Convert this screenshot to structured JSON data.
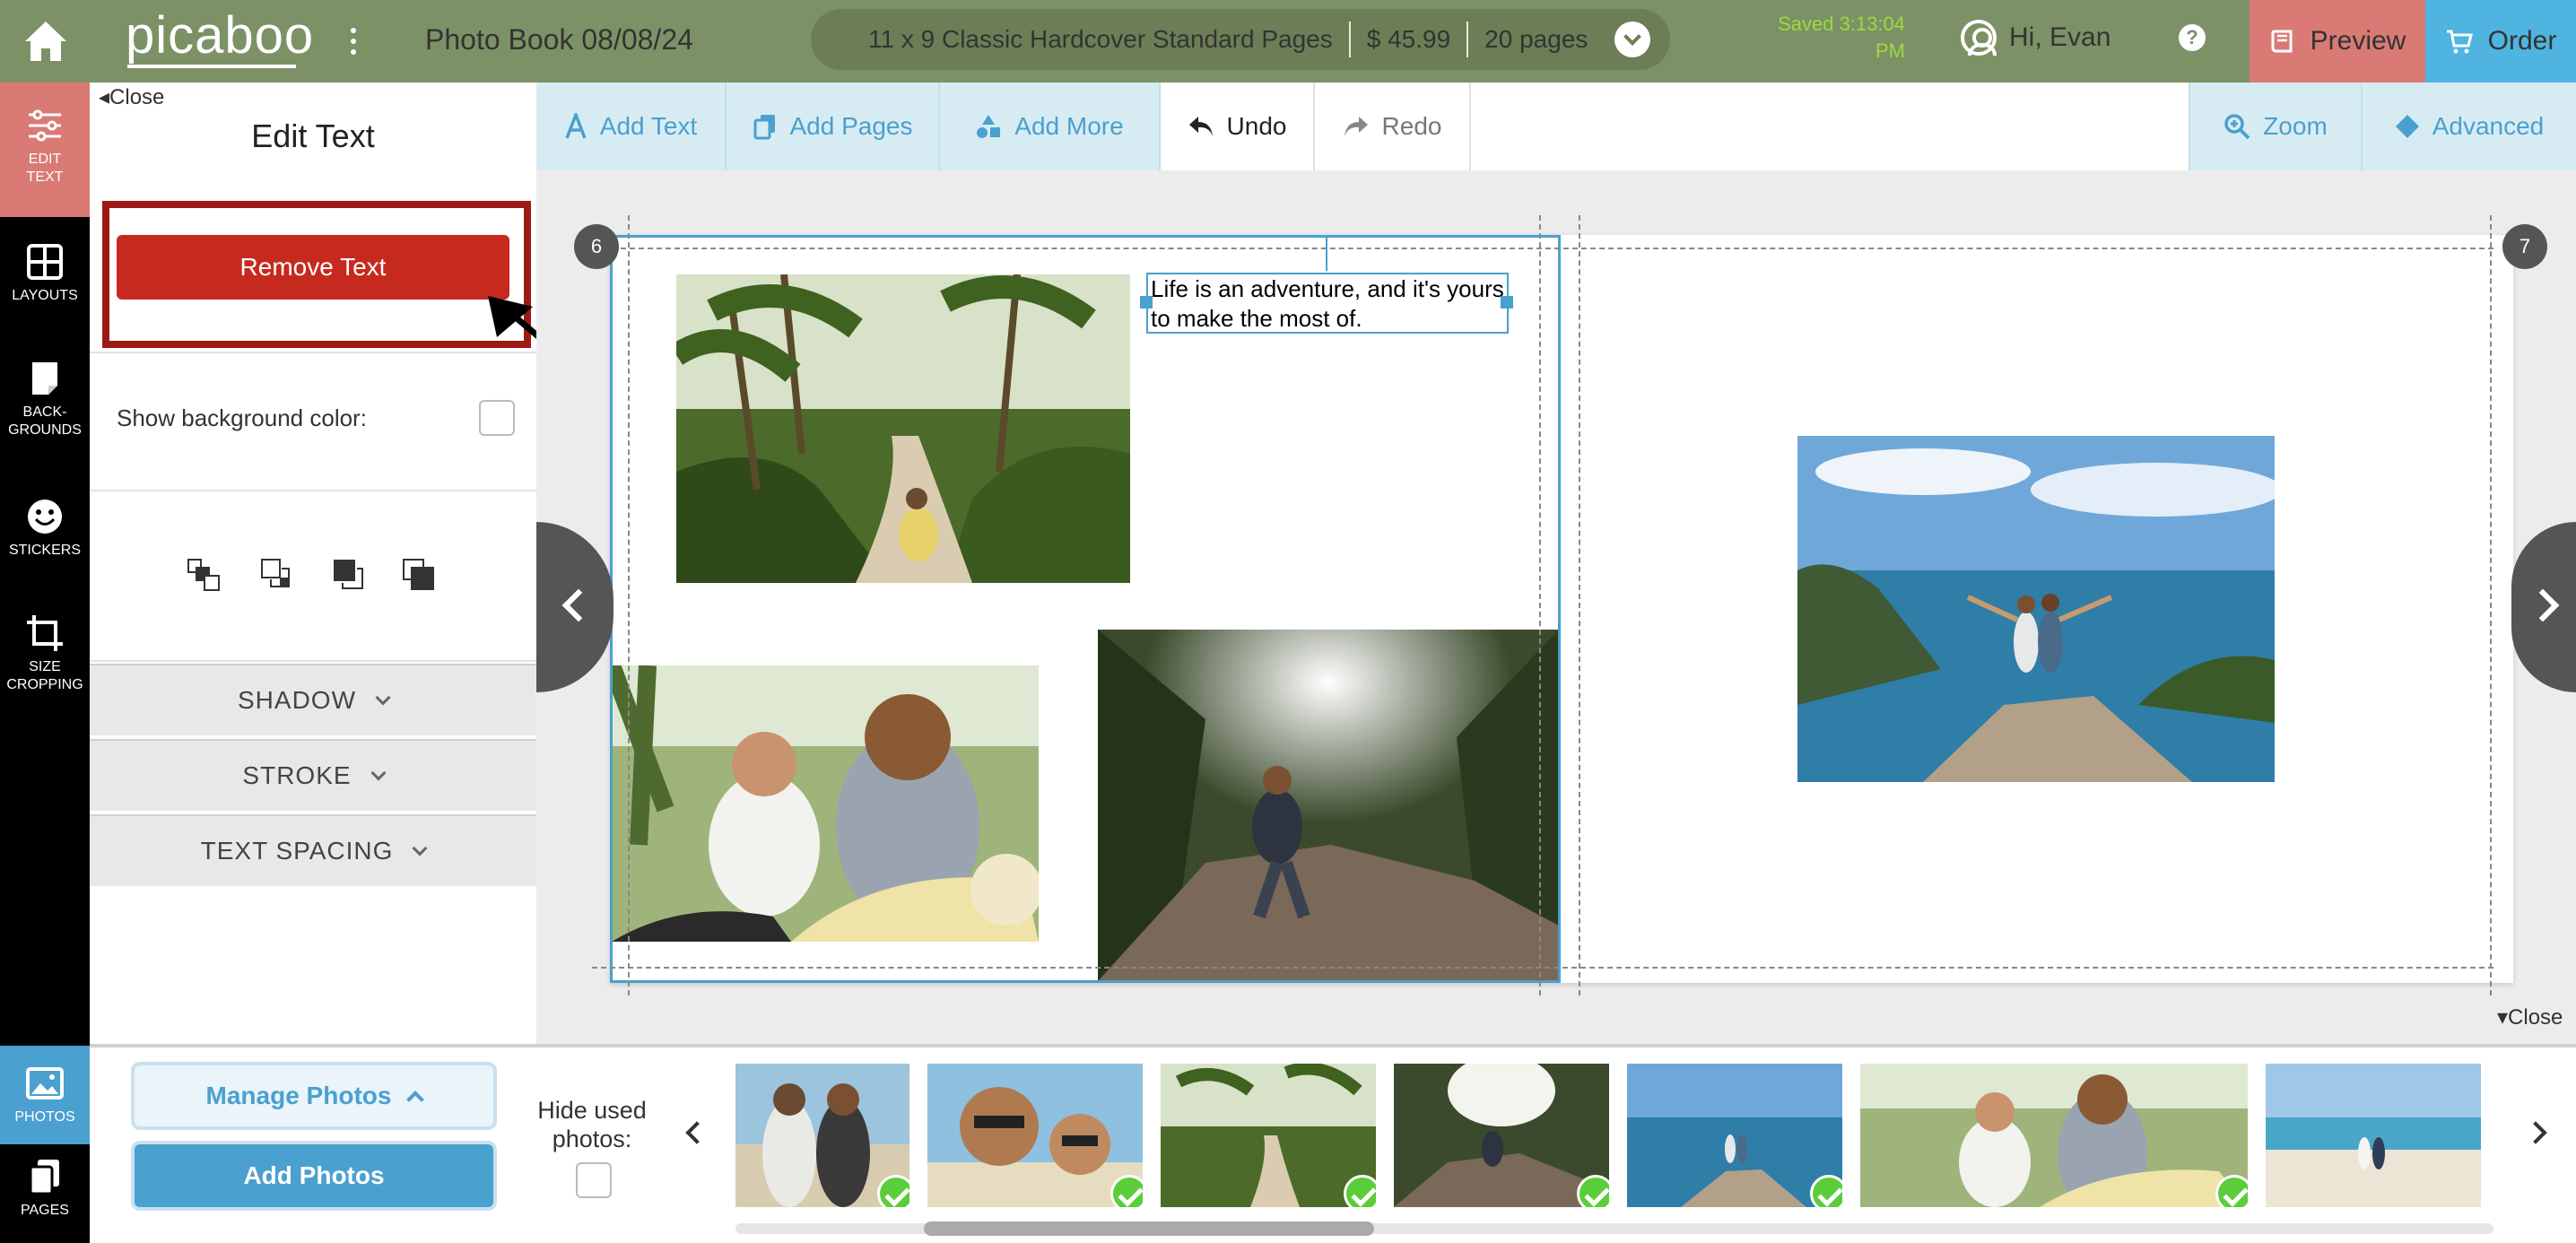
{
  "header": {
    "logo": "picaboo",
    "book_title": "Photo Book 08/08/24",
    "product": "11 x 9 Classic Hardcover Standard Pages",
    "price": "$ 45.99",
    "pages": "20 pages",
    "saved_line1": "Saved 3:13:04",
    "saved_line2": "PM",
    "greeting": "Hi, Evan",
    "help": "?",
    "preview_label": "Preview",
    "order_label": "Order"
  },
  "rail": {
    "edit_text": [
      "EDIT",
      "TEXT"
    ],
    "layouts": "LAYOUTS",
    "backgrounds": [
      "BACK-",
      "GROUNDS"
    ],
    "stickers": "STICKERS",
    "size_cropping": [
      "SIZE",
      "CROPPING"
    ],
    "photos": "PHOTOS",
    "pages": "PAGES"
  },
  "panel": {
    "close": "Close",
    "title": "Edit Text",
    "remove_text": "Remove Text",
    "show_bg_label": "Show background color:",
    "accordions": [
      "SHADOW",
      "STROKE",
      "TEXT SPACING"
    ]
  },
  "toolbar": {
    "add_text": "Add Text",
    "add_pages": "Add Pages",
    "add_more": "Add More",
    "undo": "Undo",
    "redo": "Redo",
    "zoom": "Zoom",
    "advanced": "Advanced"
  },
  "canvas": {
    "left_page_number": "6",
    "right_page_number": "7",
    "text_line1": "Life is an adventure, and it's yours",
    "text_line2": "to make the most of.",
    "close": "Close"
  },
  "photos_bar": {
    "manage_photos": "Manage Photos",
    "add_photos": "Add Photos",
    "hide_used_line1": "Hide used",
    "hide_used_line2": "photos:"
  },
  "colors": {
    "header_bg": "#7d9166",
    "preview_bg": "#d97a75",
    "order_bg": "#4fb4e0",
    "remove_btn": "#c62a1e",
    "accent_blue": "#4aa0cf",
    "saved_green": "#9ed940",
    "check_green": "#5ccd3a"
  }
}
